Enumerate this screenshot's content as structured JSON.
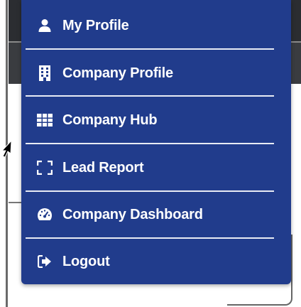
{
  "menu": {
    "items": [
      {
        "label": "My Profile",
        "icon": "user-icon"
      },
      {
        "label": "Company Profile",
        "icon": "building-icon"
      },
      {
        "label": "Company Hub",
        "icon": "grid-icon"
      },
      {
        "label": "Lead Report",
        "icon": "frame-icon"
      },
      {
        "label": "Company Dashboard",
        "icon": "tachometer-icon"
      },
      {
        "label": "Logout",
        "icon": "sign-out-icon"
      }
    ],
    "background_color": "#213c8c",
    "text_color": "#ffffff"
  }
}
